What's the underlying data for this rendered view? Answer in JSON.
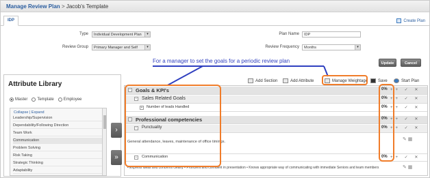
{
  "breadcrumb": {
    "link": "Manage Review Plan",
    "separator": ">",
    "current": "Jacob's Template"
  },
  "tab": {
    "label": "IDP"
  },
  "create_plan": "Create Plan",
  "form": {
    "type_label": "Type",
    "type_value": "Individual Development Plan",
    "review_group_label": "Review Group",
    "review_group_value": "Primary Manager and Self",
    "plan_name_label": "Plan Name",
    "plan_name_value": "IDP",
    "review_frequency_label": "Review Frequency",
    "review_frequency_value": "Months"
  },
  "buttons": {
    "update": "Update",
    "cancel": "Cancel"
  },
  "annotation": "For a manager to set the goals for a periodic review plan",
  "library": {
    "title": "Attribute Library",
    "radios": [
      "Master",
      "Template",
      "Employee"
    ],
    "selected_radio": "Master",
    "collapse": "Collapse",
    "link_sep": "|",
    "expand": "Expand",
    "items": [
      "Leadership/Supervision",
      "Dependability/Following Direction",
      "Team Work",
      "Communication",
      "Problem Solving",
      "Risk Taking",
      "Strategic Thinking",
      "Adaptability"
    ]
  },
  "toolbar": {
    "add_section": "Add Section",
    "add_attribute": "Add Attribute",
    "manage_weightage": "Manage Weightage",
    "save": "Save",
    "start_plan": "Start Plan"
  },
  "plan_rows": {
    "goals": {
      "label": "Goals & KPI's",
      "weight": "0%"
    },
    "sales": {
      "label": "Sales Related Goals",
      "weight": "0%"
    },
    "leads": {
      "label": "Number of leads Handled",
      "weight": "0%"
    },
    "prof": {
      "label": "Professional competencies",
      "weight": "0%"
    },
    "punct": {
      "label": "Punctuality",
      "weight": "0%"
    },
    "punct_desc": "General attendance, leaves, maintenance of office timings.",
    "comm": {
      "label": "Communication",
      "weight": "0%"
    },
    "comm_desc": "• Express ideas and concerns clearly • Proficient and confident in presentation • Knows appropriate way of communicating with immediate Seniors and team members"
  },
  "row_controls": "++ ✓ ✕"
}
